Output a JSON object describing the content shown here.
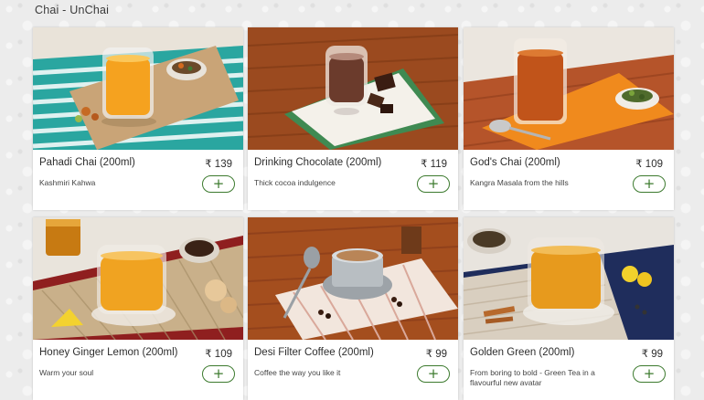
{
  "page": {
    "title": "Chai - UnChai"
  },
  "items": [
    {
      "name": "Pahadi Chai (200ml)",
      "price": "₹ 139",
      "description": "Kashmiri Kahwa",
      "add_label": "+"
    },
    {
      "name": "Drinking Chocolate (200ml)",
      "price": "₹ 119",
      "description": "Thick cocoa indulgence",
      "add_label": "+"
    },
    {
      "name": "God's Chai (200ml)",
      "price": "₹ 109",
      "description": "Kangra Masala from the hills",
      "add_label": "+"
    },
    {
      "name": "Honey Ginger Lemon (200ml)",
      "price": "₹ 109",
      "description": "Warm your soul",
      "add_label": "+"
    },
    {
      "name": "Desi Filter Coffee (200ml)",
      "price": "₹ 99",
      "description": "Coffee the way you like it",
      "add_label": "+"
    },
    {
      "name": "Golden Green (200ml)",
      "price": "₹ 99",
      "description": "From boring to bold - Green Tea in a flavourful new avatar",
      "add_label": "+"
    }
  ],
  "colors": {
    "accent": "#3c7a2e",
    "background": "#ececec"
  }
}
